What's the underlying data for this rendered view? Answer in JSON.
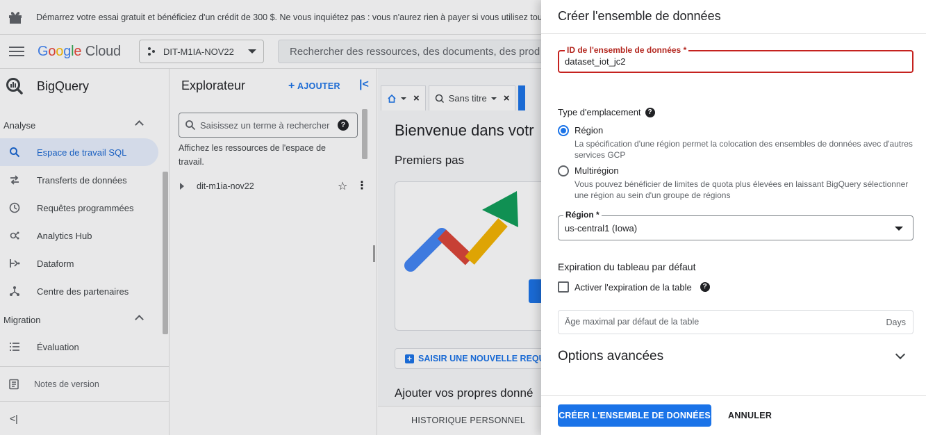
{
  "banner": {
    "text": "Démarrez votre essai gratuit et bénéficiez d'un crédit de 300 $. Ne vous inquiétez pas : vous n'aurez rien à payer si vous utilisez tout votre"
  },
  "topbar": {
    "logo_google": [
      "G",
      "o",
      "o",
      "g",
      "l",
      "e"
    ],
    "logo_cloud": "Cloud",
    "project": "DIT-M1IA-NOV22",
    "search_placeholder": "Rechercher des ressources, des documents, des prod"
  },
  "leftnav": {
    "product": "BigQuery",
    "sections": [
      {
        "label": "Analyse",
        "items": [
          "Espace de travail SQL",
          "Transferts de données",
          "Requêtes programmées",
          "Analytics Hub",
          "Dataform",
          "Centre des partenaires"
        ]
      },
      {
        "label": "Migration",
        "items": [
          "Évaluation"
        ]
      }
    ],
    "release_notes": "Notes de version",
    "collapse": "<|"
  },
  "explorer": {
    "title": "Explorateur",
    "add_label": "AJOUTER",
    "search_placeholder": "Saisissez un terme à rechercher",
    "hint": "Affichez les ressources de l'espace de travail.",
    "node": "dit-m1ia-nov22"
  },
  "main": {
    "tab_untitled": "Sans titre",
    "welcome": "Bienvenue dans votr",
    "getting_started": "Premiers pas",
    "new_query": "SAISIR UNE NOUVELLE REQUÊ",
    "own_data": "Ajouter vos propres donné",
    "history_tab": "HISTORIQUE PERSONNEL"
  },
  "panel": {
    "title": "Créer l'ensemble de données",
    "id_label": "ID de l'ensemble de données *",
    "id_value": "dataset_iot_jc2",
    "location_type": "Type d'emplacement",
    "region_option": "Région",
    "region_desc": "La spécification d'une région permet la colocation des ensembles de données avec d'autres services GCP",
    "multiregion_option": "Multirégion",
    "multiregion_desc": "Vous pouvez bénéficier de limites de quota plus élevées en laissant BigQuery sélectionner une région au sein d'un groupe de régions",
    "region_label": "Région *",
    "region_value": "us-central1 (Iowa)",
    "expiration_title": "Expiration du tableau par défaut",
    "expiration_checkbox": "Activer l'expiration de la table",
    "age_placeholder": "Âge maximal par défaut de la table",
    "age_suffix": "Days",
    "advanced": "Options avancées",
    "create_button": "CRÉER L'ENSEMBLE DE DONNÉES",
    "cancel_button": "ANNULER"
  },
  "colors": {
    "primary": "#1a73e8",
    "error": "#c5221f"
  }
}
